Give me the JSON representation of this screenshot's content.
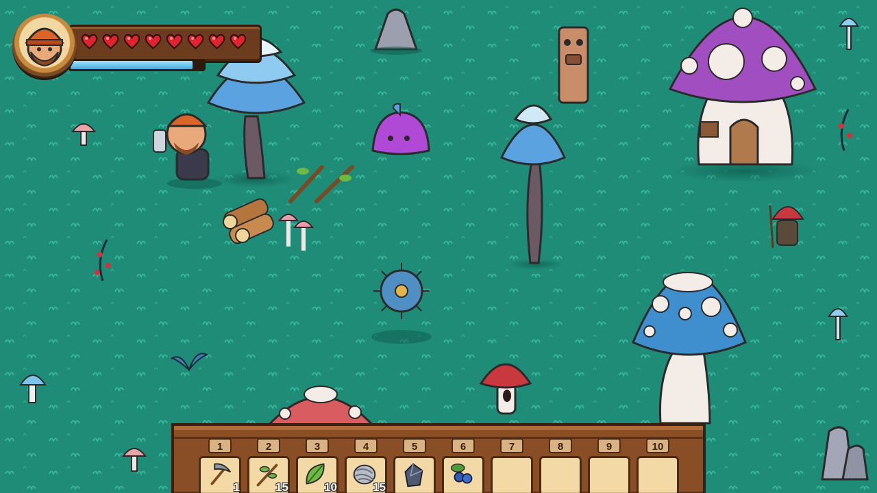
{
  "player": {
    "portrait_icon": "lumberjack-portrait-icon",
    "health": {
      "current": 8,
      "max": 8
    },
    "stamina_fraction": 0.92
  },
  "hotbar": {
    "slots": [
      {
        "number": "1",
        "item": "pickaxe-icon",
        "count": "1"
      },
      {
        "number": "2",
        "item": "stick-icon",
        "count": "15"
      },
      {
        "number": "3",
        "item": "leaf-icon",
        "count": "10"
      },
      {
        "number": "4",
        "item": "fiber-icon",
        "count": "15"
      },
      {
        "number": "5",
        "item": "crystal-icon",
        "count": ""
      },
      {
        "number": "6",
        "item": "berry-icon",
        "count": ""
      },
      {
        "number": "7",
        "item": "",
        "count": ""
      },
      {
        "number": "8",
        "item": "",
        "count": ""
      },
      {
        "number": "9",
        "item": "",
        "count": ""
      },
      {
        "number": "10",
        "item": "",
        "count": ""
      }
    ]
  },
  "colors": {
    "grass": "#1f8c78",
    "heart": "#e0232e",
    "stamina": "#48a8dd",
    "wood": "#8a4e26"
  }
}
